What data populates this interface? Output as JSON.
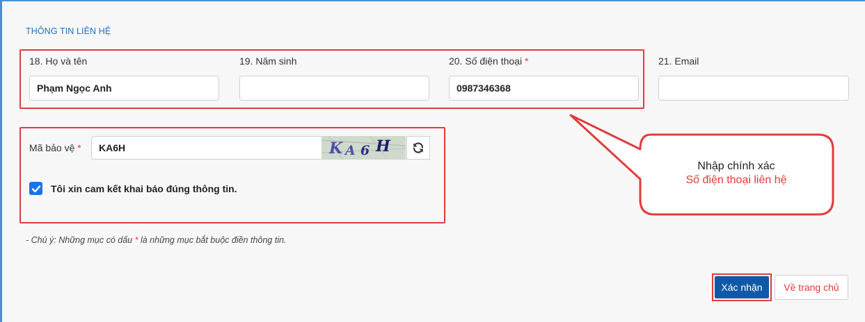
{
  "section": {
    "title": "THÔNG TIN LIÊN HỆ"
  },
  "fields": [
    {
      "label": "18. Họ và tên",
      "value": "Phạm Ngọc Anh",
      "required": false
    },
    {
      "label": "19. Năm sinh",
      "value": "",
      "required": false
    },
    {
      "label": "20. Số điện thoại",
      "value": "0987346368",
      "required": true
    },
    {
      "label": "21. Email",
      "value": "",
      "required": false
    }
  ],
  "required_marker": "*",
  "captcha": {
    "label": "Mã bảo vệ",
    "value": "KA6H",
    "image_text": "KA6H",
    "refresh_icon": "refresh-icon"
  },
  "commitment": {
    "checked": true,
    "label": "Tôi xin cam kết khai báo đúng thông tin."
  },
  "note": {
    "prefix": "- Chú ý: Những mục có dấu ",
    "marker": "*",
    "suffix": " là những mục bắt buộc điền thông tin."
  },
  "callout": {
    "line1": "Nhập chính xác",
    "line2": "Số điện thoại liên hệ"
  },
  "buttons": {
    "confirm": "Xác nhận",
    "home": "Về trang chủ"
  },
  "colors": {
    "accent": "#1f6fc5",
    "primary_button": "#0f5aa8",
    "highlight": "#e03c3c",
    "required": "#e53935"
  }
}
